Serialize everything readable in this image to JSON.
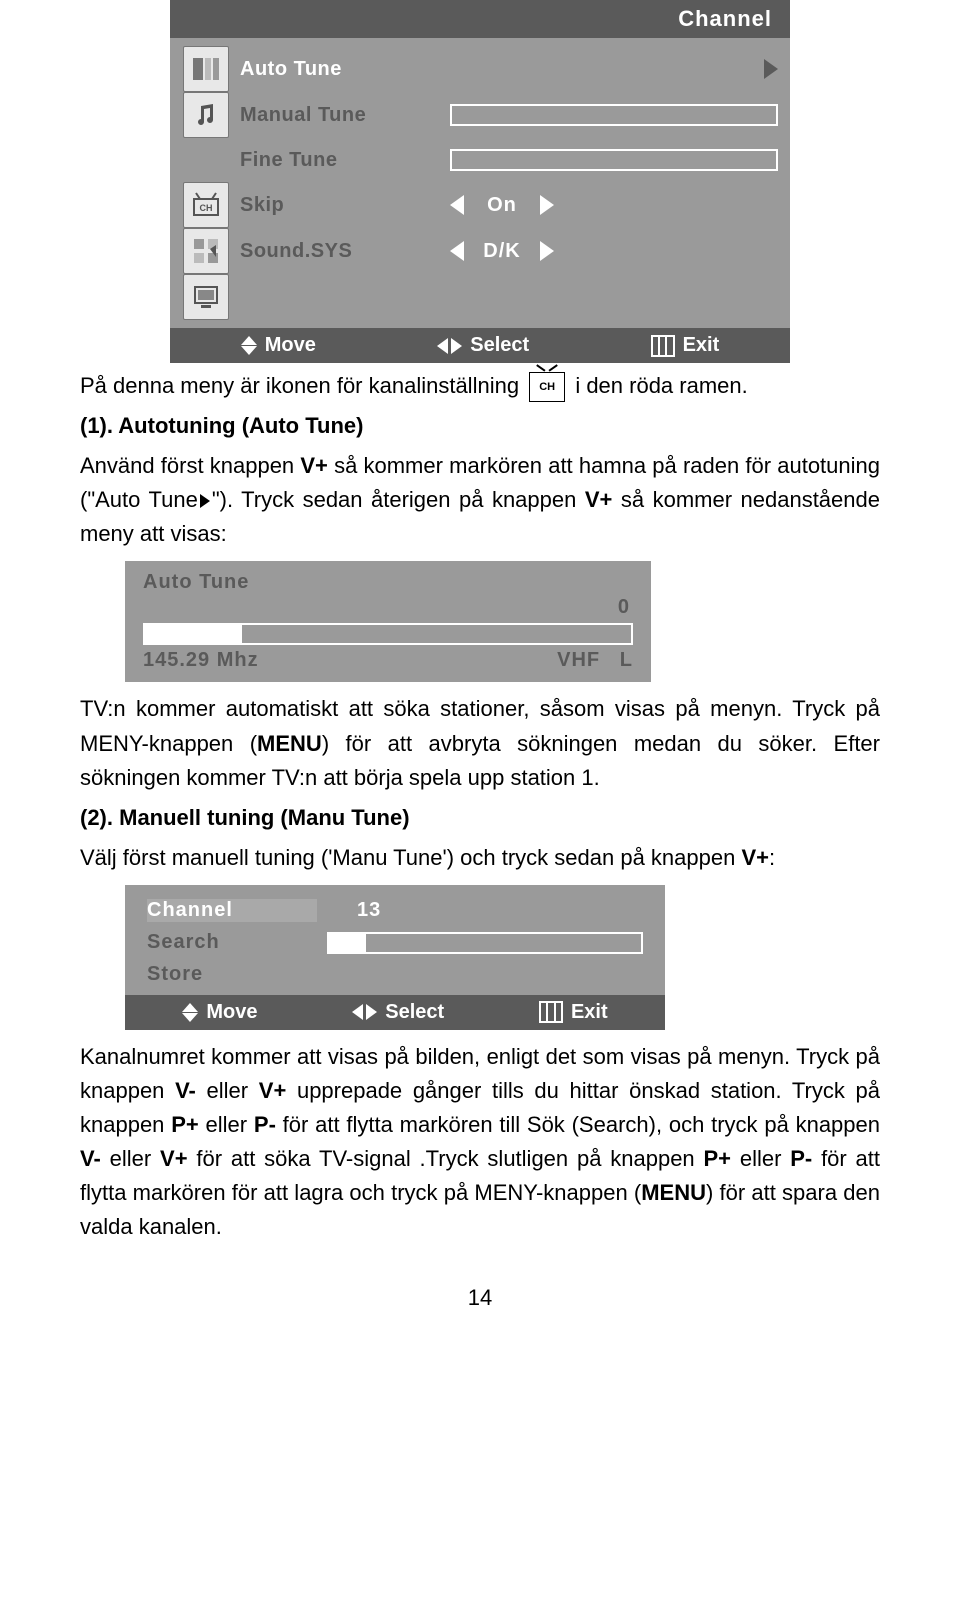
{
  "osdMain": {
    "title": "Channel",
    "rows": {
      "autoTune": "Auto Tune",
      "manualTune": "Manual Tune",
      "fineTune": "Fine Tune",
      "skip": {
        "label": "Skip",
        "value": "On"
      },
      "soundSys": {
        "label": "Sound.SYS",
        "value": "D/K"
      }
    },
    "footer": {
      "move": "Move",
      "select": "Select",
      "exit": "Exit"
    }
  },
  "text": {
    "line1a": "På denna meny är ikonen för kanalinställning",
    "line1b": "i den röda ramen.",
    "sec1Title": "(1). Autotuning (Auto Tune)",
    "sec1p1a": "Använd först knappen ",
    "sec1p1b": "V+",
    "sec1p1c": " så kommer markören att hamna på raden för autotuning (\"Auto Tune",
    "sec1p1d": "\"). Tryck sedan återigen på knappen ",
    "sec1p1e": "V+",
    "sec1p1f": " så kommer nedanstående meny att visas:",
    "sec1p2a": "TV:n kommer automatiskt att söka stationer, såsom visas på menyn. Tryck på MENY-knappen (",
    "sec1p2b": "MENU",
    "sec1p2c": ") för att avbryta sökningen medan du söker. Efter sökningen kommer TV:n att börja spela upp station 1.",
    "sec2Title": "(2). Manuell tuning (Manu Tune)",
    "sec2p1a": "Välj först manuell tuning ('Manu Tune') och tryck sedan på knappen ",
    "sec2p1b": "V+",
    "sec2p1c": ":",
    "sec3p1": "Kanalnumret kommer att visas på bilden, enligt det som visas på menyn. Tryck på knappen ",
    "sec3p1b": "V-",
    "sec3p1c": " eller ",
    "sec3p1d": "V+",
    "sec3p1e": " upprepade gånger tills du hittar önskad station. Tryck på knappen ",
    "sec3p1f": "P+",
    "sec3p1g": " eller ",
    "sec3p1h": "P-",
    "sec3p1i": " för att flytta markören till Sök (Search), och tryck på knappen ",
    "sec3p1j": "V-",
    "sec3p1k": " eller ",
    "sec3p1l": "V+",
    "sec3p1m": " för att söka TV-signal .Tryck slutligen på knappen ",
    "sec3p1n": "P+",
    "sec3p1o": " eller ",
    "sec3p1p": "P-",
    "sec3p1q": " för att flytta markören för att lagra och tryck på MENY-knappen (",
    "sec3p1r": "MENU",
    "sec3p1s": ") för att spara den valda kanalen."
  },
  "autoTuneBox": {
    "title": "Auto Tune",
    "count": "0",
    "freq": "145.29 Mhz",
    "band": "VHF   L"
  },
  "manuBox": {
    "channel": {
      "label": "Channel",
      "value": "13"
    },
    "search": "Search",
    "store": "Store",
    "footer": {
      "move": "Move",
      "select": "Select",
      "exit": "Exit"
    }
  },
  "inlineChLabel": "CH",
  "pageNumber": "14"
}
